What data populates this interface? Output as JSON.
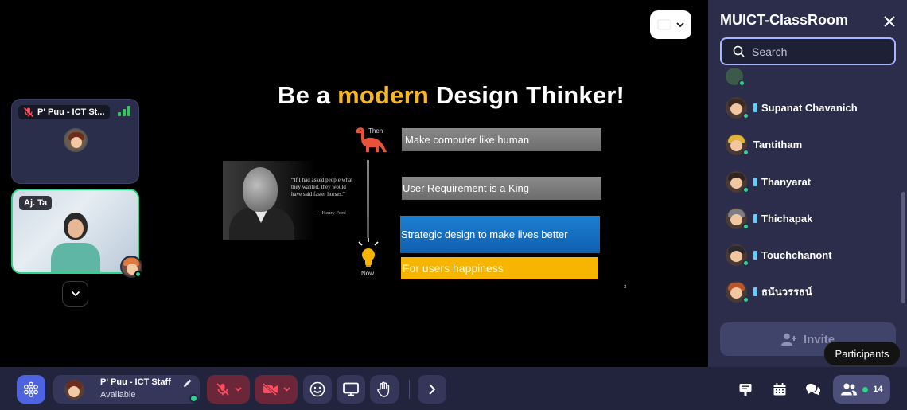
{
  "stage": {
    "tiles": [
      {
        "name": "P' Puu - ICT St...",
        "mic": "muted"
      },
      {
        "name": "Aj. Ta"
      }
    ]
  },
  "slide": {
    "title_before": "Be a ",
    "title_highlight": "modern",
    "title_after": " Design Thinker!",
    "quote": "“If I had asked people what they wanted, they would have said faster horses.”",
    "quote_author": "—Henry Ford",
    "then_label": "Then",
    "now_label": "Now",
    "boxes": [
      "Make computer like human",
      "User Requirement is a King",
      "Strategic design to make lives better",
      "For users happiness"
    ],
    "page_number": "3"
  },
  "sidebar": {
    "title": "MUICT-ClassRoom",
    "search_placeholder": "Search",
    "participants": [
      {
        "name": "Supanat Chavanich",
        "hair": "#3a2a22"
      },
      {
        "name": "Tantitham",
        "hair": "#e0b43a"
      },
      {
        "name": "Thanyarat",
        "hair": "#2f2420"
      },
      {
        "name": "Thichapak",
        "hair": "#7d7d86"
      },
      {
        "name": "Touchchanont",
        "hair": "#2b2b2b"
      },
      {
        "name": "ธนันวรรธน์",
        "hair": "#b8572c"
      }
    ],
    "invite_label": "Invite",
    "tooltip": "Participants"
  },
  "toolbar": {
    "self_name": "P' Puu - ICT Staff",
    "self_status": "Available",
    "participant_count": "14"
  },
  "colors": {
    "accent": "#4e63e0",
    "online": "#2fd38a",
    "muted_bg": "#6b2639",
    "highlight": "#f5b723"
  }
}
